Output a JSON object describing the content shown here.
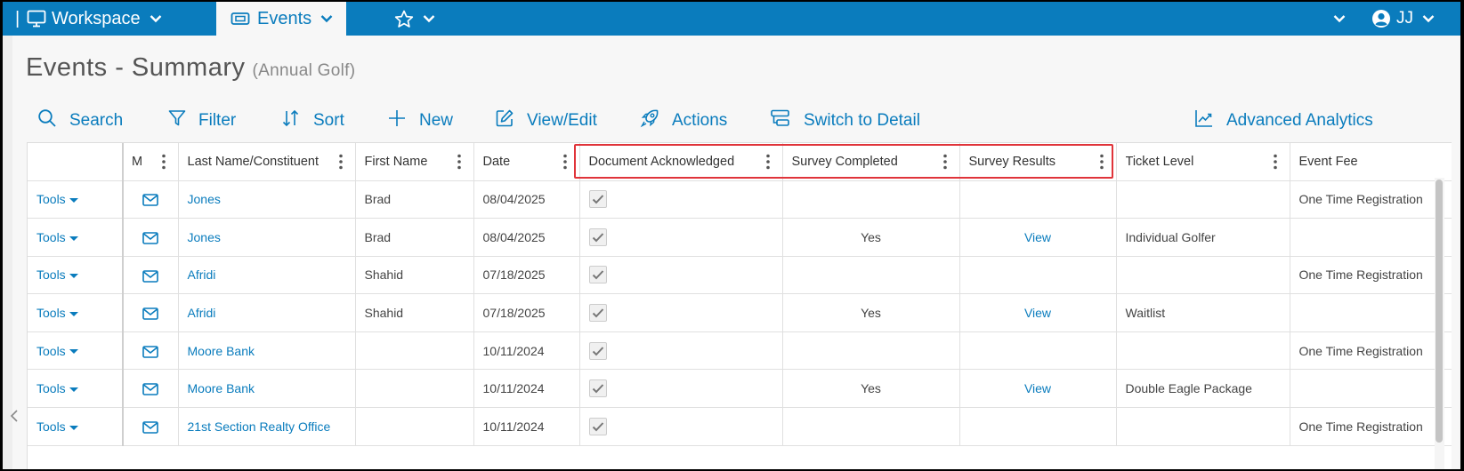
{
  "nav": {
    "pipe": "|",
    "workspace_label": "Workspace",
    "events_label": "Events",
    "user_initials": "JJ"
  },
  "page": {
    "title": "Events - Summary",
    "subtitle": "(Annual Golf)"
  },
  "toolbar": {
    "search": "Search",
    "filter": "Filter",
    "sort": "Sort",
    "new": "New",
    "view_edit": "View/Edit",
    "actions": "Actions",
    "switch_detail": "Switch to Detail",
    "analytics": "Advanced Analytics"
  },
  "table": {
    "columns": [
      "",
      "M",
      "Last Name/Constituent",
      "First Name",
      "Date",
      "Document Acknowledged",
      "Survey Completed",
      "Survey Results",
      "Ticket Level",
      "Event Fee"
    ],
    "tools_label": "Tools",
    "rows": [
      {
        "last": "Jones",
        "first": "Brad",
        "date": "08/04/2025",
        "survey": "",
        "results": "",
        "ticket": "",
        "fee": "One Time Registration"
      },
      {
        "last": "Jones",
        "first": "Brad",
        "date": "08/04/2025",
        "survey": "Yes",
        "results": "View",
        "ticket": "Individual Golfer",
        "fee": ""
      },
      {
        "last": "Afridi",
        "first": "Shahid",
        "date": "07/18/2025",
        "survey": "",
        "results": "",
        "ticket": "",
        "fee": "One Time Registration"
      },
      {
        "last": "Afridi",
        "first": "Shahid",
        "date": "07/18/2025",
        "survey": "Yes",
        "results": "View",
        "ticket": "Waitlist",
        "fee": ""
      },
      {
        "last": "Moore Bank",
        "first": "",
        "date": "10/11/2024",
        "survey": "",
        "results": "",
        "ticket": "",
        "fee": "One Time Registration"
      },
      {
        "last": "Moore Bank",
        "first": "",
        "date": "10/11/2024",
        "survey": "Yes",
        "results": "View",
        "ticket": "Double Eagle Package",
        "fee": ""
      },
      {
        "last": "21st Section Realty Office",
        "first": "",
        "date": "10/11/2024",
        "survey": "",
        "results": "",
        "ticket": "",
        "fee": "One Time Registration"
      }
    ]
  },
  "colors": {
    "brand": "#0a7cbd",
    "highlight": "#e0343a"
  }
}
